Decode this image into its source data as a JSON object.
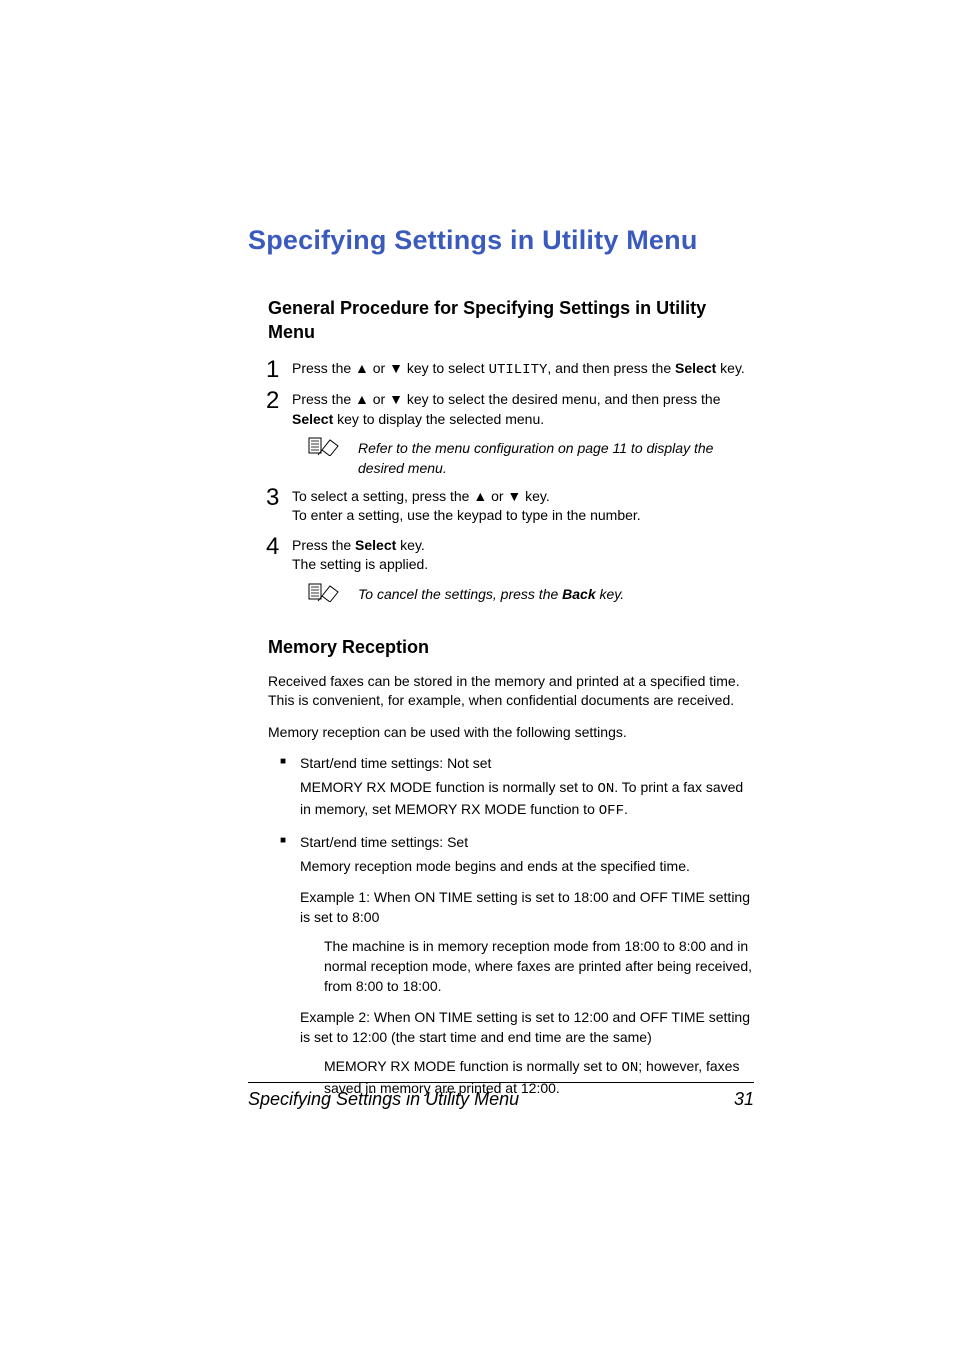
{
  "title": "Specifying Settings in Utility Menu",
  "section1": {
    "heading": "General Procedure for Specifying Settings in Utility Menu",
    "step1": {
      "prefix": "Press the ▲ or ▼ key to select ",
      "mono": "UTILITY",
      "mid": ", and then press the ",
      "bold": "Select",
      "suffix": " key."
    },
    "step2": {
      "line1_prefix": "Press the ▲ or ▼ key to select the desired menu, and then press the ",
      "line1_bold": "Select",
      "line1_suffix": " key to display the selected menu."
    },
    "note1": "Refer to the menu configuration on page 11 to display the desired menu.",
    "step3": {
      "line1": "To select a setting, press the ▲ or ▼ key.",
      "line2": "To enter a setting, use the keypad to type in the number."
    },
    "step4": {
      "line1_prefix": "Press the ",
      "line1_bold": "Select",
      "line1_suffix": " key.",
      "line2": "The setting is applied."
    },
    "note2_prefix": "To cancel the settings, press the ",
    "note2_bold": "Back",
    "note2_suffix": " key."
  },
  "section2": {
    "heading": "Memory Reception",
    "para1": "Received faxes can be stored in the memory and printed at a specified time. This is convenient, for example, when confidential documents are received.",
    "para2": "Memory reception can be used with the following settings.",
    "bullet1_head": "Start/end time settings: Not set",
    "bullet1_body_pre": "MEMORY RX MODE function is normally set to ",
    "bullet1_mono1": "ON",
    "bullet1_body_mid": ". To print a fax saved in memory, set MEMORY RX MODE function to ",
    "bullet1_mono2": "OFF",
    "bullet1_body_suf": ".",
    "bullet2_head": "Start/end time settings: Set",
    "bullet2_body": "Memory reception mode begins and ends at the specified time.",
    "example1": "Example 1: When ON TIME setting is set to 18:00 and OFF TIME setting is set to 8:00",
    "example1_detail": "The machine is in memory reception mode from 18:00 to 8:00 and in normal reception mode, where faxes are printed after being received, from 8:00 to 18:00.",
    "example2": "Example 2: When ON TIME setting is set to 12:00 and OFF TIME setting is set to 12:00 (the start time and end time are the same)",
    "example2_detail_pre": "MEMORY RX MODE function is normally set to ",
    "example2_mono": "ON",
    "example2_detail_suf": "; however, faxes saved in memory are printed at 12:00."
  },
  "footer": {
    "title": "Specifying Settings in Utility Menu",
    "page": "31"
  }
}
